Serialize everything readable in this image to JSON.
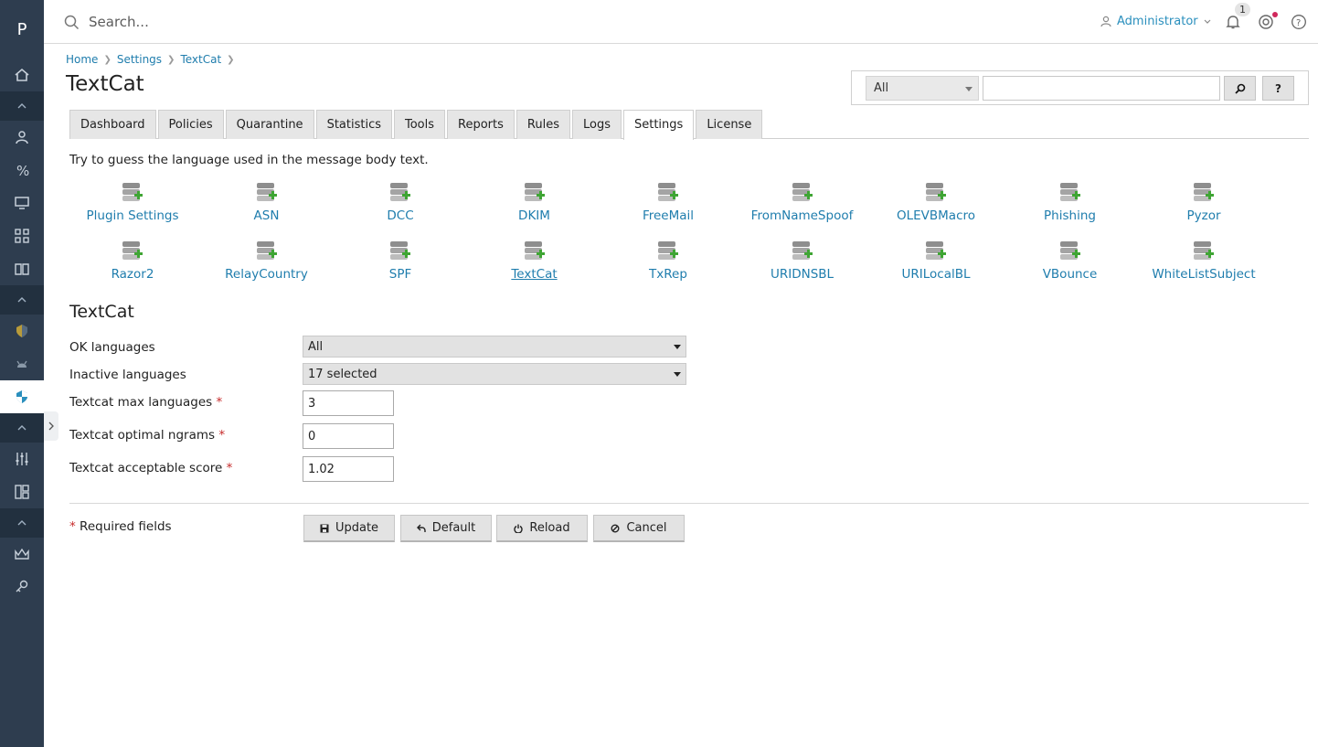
{
  "rail": {
    "logo": "P"
  },
  "topbar": {
    "search_placeholder": "Search...",
    "user": "Administrator",
    "notifications_count": "1"
  },
  "breadcrumb": [
    "Home",
    "Settings",
    "TextCat"
  ],
  "page_title": "TextCat",
  "quick_search": {
    "selected": "All",
    "help_label": "?"
  },
  "tabs": [
    "Dashboard",
    "Policies",
    "Quarantine",
    "Statistics",
    "Tools",
    "Reports",
    "Rules",
    "Logs",
    "Settings",
    "License"
  ],
  "active_tab": "Settings",
  "description": "Try to guess the language used in the message body text.",
  "plugins": [
    "Plugin Settings",
    "ASN",
    "DCC",
    "DKIM",
    "FreeMail",
    "FromNameSpoof",
    "OLEVBMacro",
    "Phishing",
    "Pyzor",
    "Razor2",
    "RelayCountry",
    "SPF",
    "TextCat",
    "TxRep",
    "URIDNSBL",
    "URILocalBL",
    "VBounce",
    "WhiteListSubject"
  ],
  "current_plugin": "TextCat",
  "form": {
    "section_title": "TextCat",
    "ok_languages_label": "OK languages",
    "ok_languages_value": "All",
    "inactive_languages_label": "Inactive languages",
    "inactive_languages_value": "17 selected",
    "max_languages_label": "Textcat max languages",
    "max_languages_value": "3",
    "optimal_ngrams_label": "Textcat optimal ngrams",
    "optimal_ngrams_value": "0",
    "acceptable_score_label": "Textcat acceptable score",
    "acceptable_score_value": "1.02",
    "required_mark": "*",
    "required_note": "Required fields"
  },
  "actions": {
    "update": "Update",
    "default": "Default",
    "reload": "Reload",
    "cancel": "Cancel"
  },
  "colors": {
    "rail": "#2e3d4f",
    "link": "#1f7dad",
    "required": "#c62a2a"
  }
}
